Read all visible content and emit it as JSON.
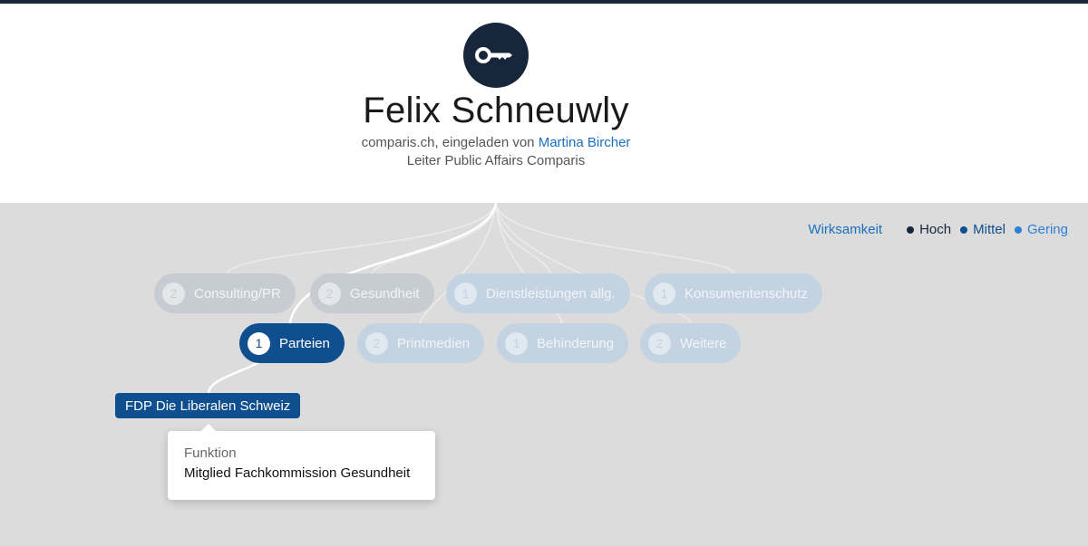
{
  "person": {
    "name": "Felix Schneuwly",
    "company": "comparis.ch",
    "invited_prefix": ", eingeladen von ",
    "invited_by": "Martina Bircher",
    "role": "Leiter Public Affairs Comparis",
    "avatar_icon": "key-icon"
  },
  "legend": {
    "label": "Wirksamkeit",
    "items": [
      {
        "label": "Hoch",
        "color": "#17263a"
      },
      {
        "label": "Mittel",
        "color": "#0f4f8f"
      },
      {
        "label": "Gering",
        "color": "#2d7fd6"
      }
    ]
  },
  "categories_row1": [
    {
      "count": "2",
      "label": "Consulting/PR"
    },
    {
      "count": "2",
      "label": "Gesundheit"
    },
    {
      "count": "1",
      "label": "Dienstleistungen allg."
    },
    {
      "count": "1",
      "label": "Konsumentenschutz"
    }
  ],
  "categories_row2": [
    {
      "count": "1",
      "label": "Parteien"
    },
    {
      "count": "2",
      "label": "Printmedien"
    },
    {
      "count": "1",
      "label": "Behinderung"
    },
    {
      "count": "2",
      "label": "Weitere"
    }
  ],
  "organization": {
    "label": "FDP Die Liberalen Schweiz"
  },
  "tooltip": {
    "title": "Funktion",
    "value": "Mitglied Fachkommission Gesundheit"
  },
  "colors": {
    "dark_navy": "#17263a",
    "active_blue": "#0f4f8f",
    "link_blue": "#1a6fc0",
    "background_grey": "#dcdcdc"
  }
}
